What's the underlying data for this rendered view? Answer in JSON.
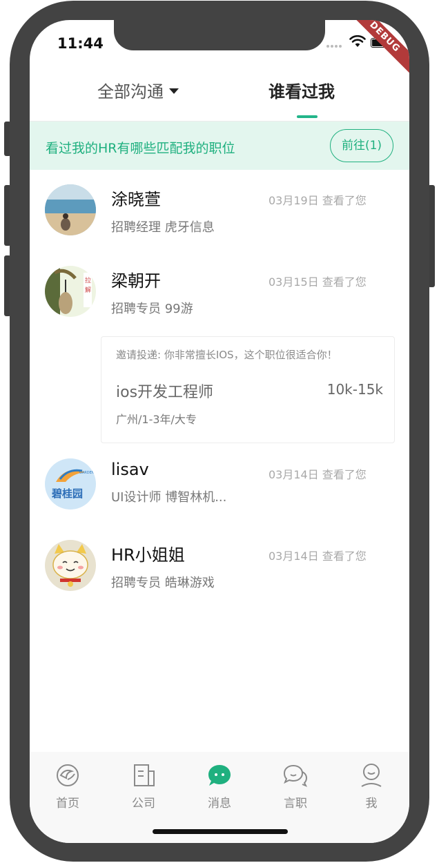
{
  "status": {
    "time": "11:44",
    "debug_label": "DEBUG"
  },
  "header": {
    "tab_all": "全部沟通",
    "tab_viewed": "谁看过我"
  },
  "banner": {
    "text": "看过我的HR有哪些匹配我的职位",
    "button": "前往(1)"
  },
  "viewers": [
    {
      "name": "涂晓萱",
      "meta": "03月19日 查看了您",
      "sub": "招聘经理 虎牙信息"
    },
    {
      "name": "梁朝开",
      "meta": "03月15日 查看了您",
      "sub": "招聘专员 99游"
    },
    {
      "name": "lisav",
      "meta": "03月14日 查看了您",
      "sub": "UI设计师 博智林机..."
    },
    {
      "name": "HR小姐姐",
      "meta": "03月14日 查看了您",
      "sub": "招聘专员 皓琳游戏"
    }
  ],
  "job_card": {
    "invite": "邀请投递: 你非常擅长IOS，这个职位很适合你！",
    "title": "ios开发工程师",
    "salary": "10k-15k",
    "location": "广州/1-3年/大专"
  },
  "tabbar": {
    "items": [
      {
        "label": "首页",
        "icon": "home-icon"
      },
      {
        "label": "公司",
        "icon": "company-icon"
      },
      {
        "label": "消息",
        "icon": "message-icon"
      },
      {
        "label": "言职",
        "icon": "chat-icon"
      },
      {
        "label": "我",
        "icon": "profile-icon"
      }
    ]
  },
  "colors": {
    "accent": "#1fb07f",
    "frame": "#434343",
    "banner_bg": "#e3f6ee"
  }
}
